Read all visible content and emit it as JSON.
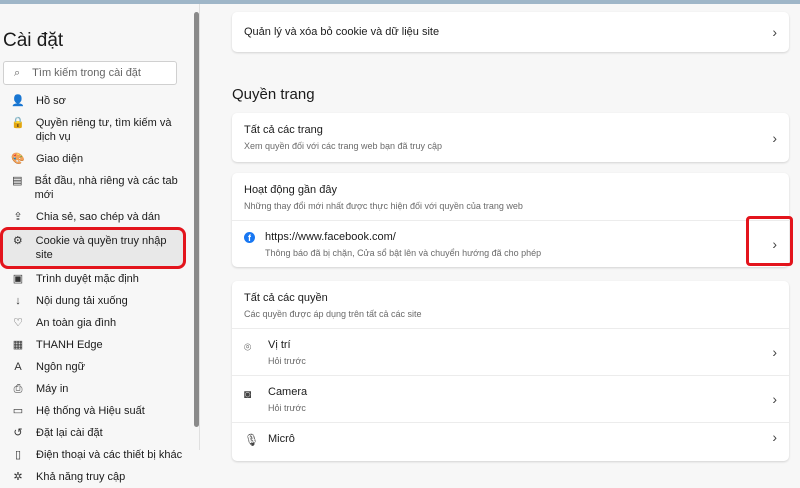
{
  "sidebar": {
    "title": "Cài đặt",
    "search_placeholder": "Tìm kiếm trong cài đặt",
    "items": [
      {
        "label": "Hồ sơ",
        "icon": "👤"
      },
      {
        "label": "Quyền riêng tư, tìm kiếm và dịch vụ",
        "icon": "🔒"
      },
      {
        "label": "Giao diện",
        "icon": "🎨"
      },
      {
        "label": "Bắt đầu, nhà riêng và các tab mới",
        "icon": "▤"
      },
      {
        "label": "Chia sẻ, sao chép và dán",
        "icon": "⇪"
      },
      {
        "label": "Cookie và quyền truy nhập site",
        "icon": "⚙"
      },
      {
        "label": "Trình duyệt mặc định",
        "icon": "▣"
      },
      {
        "label": "Nội dung tải xuống",
        "icon": "↓"
      },
      {
        "label": "An toàn gia đình",
        "icon": "♡"
      },
      {
        "label": "THANH Edge",
        "icon": "▦"
      },
      {
        "label": "Ngôn ngữ",
        "icon": "A"
      },
      {
        "label": "Máy in",
        "icon": "⎙"
      },
      {
        "label": "Hệ thống và Hiệu suất",
        "icon": "▭"
      },
      {
        "label": "Đặt lại cài đặt",
        "icon": "↺"
      },
      {
        "label": "Điện thoại và các thiết bị khác",
        "icon": "▯"
      },
      {
        "label": "Khả năng truy cập",
        "icon": "✲"
      }
    ]
  },
  "main": {
    "manage_cookies": "Quản lý và xóa bỏ cookie và dữ liệu site",
    "section_title": "Quyền trang",
    "all_sites": {
      "title": "Tất cả các trang",
      "desc": "Xem quyền đối với các trang web bạn đã truy cập"
    },
    "recent": {
      "title": "Hoạt động gần đây",
      "desc": "Những thay đổi mới nhất được thực hiện đối với quyền của trang web",
      "site": "https://www.facebook.com/",
      "site_desc": "Thông báo đã bị chặn, Cửa sổ bật lên và chuyển hướng đã cho phép"
    },
    "all_perms": {
      "title": "Tất cả các quyền",
      "desc": "Các quyền được áp dụng trên tất cả các site",
      "items": [
        {
          "label": "Vị trí",
          "desc": "Hỏi trước"
        },
        {
          "label": "Camera",
          "desc": "Hỏi trước"
        },
        {
          "label": "Micrô"
        }
      ]
    }
  }
}
